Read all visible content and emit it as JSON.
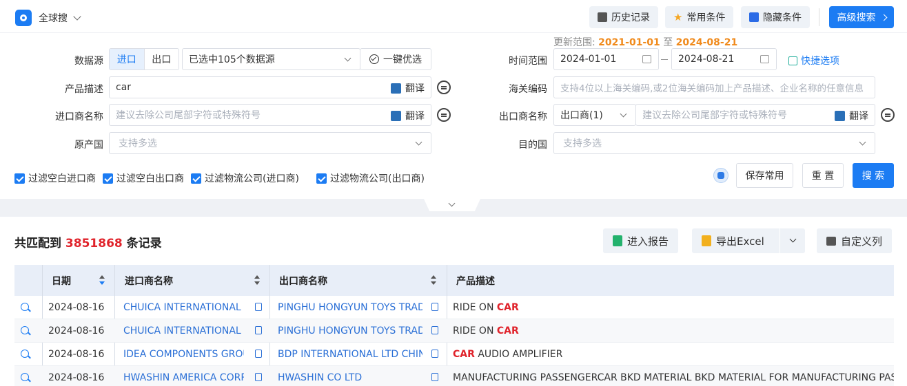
{
  "topbar": {
    "scope_label": "全球搜",
    "history_label": "历史记录",
    "common_label": "常用条件",
    "hide_label": "隐藏条件",
    "advanced_label": "高级搜索"
  },
  "update_range": {
    "prefix": "更新范围:",
    "start": "2021-01-01",
    "sep": "至",
    "end": "2024-08-21"
  },
  "form": {
    "datasource_label": "数据源",
    "import_tab": "进口",
    "export_tab": "出口",
    "datasource_value": "已选中105个数据源",
    "optimize_label": "一键优选",
    "product_label": "产品描述",
    "product_value": "car",
    "translate_label": "翻译",
    "importer_label": "进口商名称",
    "importer_placeholder": "建议去除公司尾部字符或特殊符号",
    "origin_label": "原产国",
    "origin_placeholder": "支持多选",
    "time_label": "时间范围",
    "date_start": "2024-01-01",
    "date_end": "2024-08-21",
    "quick_label": "快捷选项",
    "hs_label": "海关编码",
    "hs_placeholder": "支持4位以上海关编码,或2位海关编码加上产品描述、企业名称的任意信息",
    "exporter_label": "出口商名称",
    "exporter_select": "出口商(1)",
    "exporter_placeholder": "建议去除公司尾部字符或特殊符号",
    "dest_label": "目的国",
    "dest_placeholder": "支持多选"
  },
  "filters": [
    "过滤空白进口商",
    "过滤空白出口商",
    "过滤物流公司(进口商)",
    "过滤物流公司(出口商)"
  ],
  "actions": {
    "save_label": "保存常用",
    "reset_label": "重 置",
    "search_label": "搜 索"
  },
  "results": {
    "prefix": "共匹配到",
    "count": "3851868",
    "suffix": "条记录",
    "report_label": "进入报告",
    "excel_label": "导出Excel",
    "custom_label": "自定义列"
  },
  "table": {
    "headers": [
      "日期",
      "进口商名称",
      "出口商名称",
      "产品描述"
    ],
    "rows": [
      {
        "date": "2024-08-16",
        "importer": "CHUICA INTERNATIONAL I",
        "exporter": "PINGHU HONGYUN TOYS TRAD",
        "desc_pre": "RIDE ON ",
        "desc_hl": "CAR",
        "desc_post": ""
      },
      {
        "date": "2024-08-16",
        "importer": "CHUICA INTERNATIONAL I",
        "exporter": "PINGHU HONGYUN TOYS TRAD",
        "desc_pre": "RIDE ON ",
        "desc_hl": "CAR",
        "desc_post": ""
      },
      {
        "date": "2024-08-16",
        "importer": "IDEA COMPONENTS GROU",
        "exporter": "BDP INTERNATIONAL LTD CHIN",
        "desc_pre": "",
        "desc_hl": "CAR",
        "desc_post": " AUDIO AMPLIFIER"
      },
      {
        "date": "2024-08-16",
        "importer": "HWASHIN AMERICA CORP",
        "exporter": "HWASHIN CO LTD",
        "desc_pre": "MANUFACTURING PASSENGERCAR BKD MATERIAL BKD MATERIAL FOR MANUFACTURING PASSEN",
        "desc_hl": "",
        "desc_post": ""
      }
    ]
  }
}
